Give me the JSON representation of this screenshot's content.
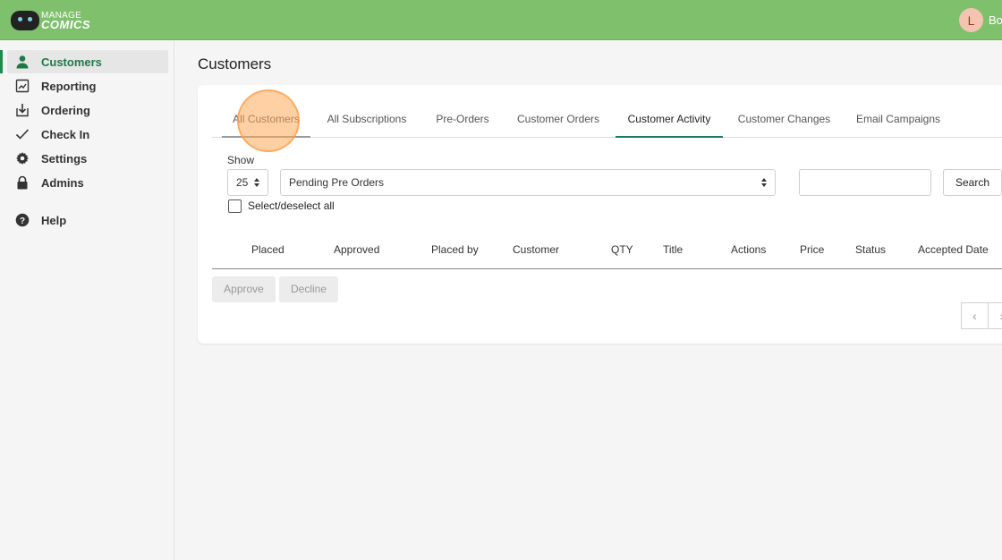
{
  "header": {
    "logo_line1": "MANAGE",
    "logo_line2": "COMICS",
    "avatar_initial": "L",
    "user_name": "Bo"
  },
  "sidebar": {
    "items": [
      {
        "label": "Customers",
        "icon": "user-icon",
        "active": true
      },
      {
        "label": "Reporting",
        "icon": "report-icon"
      },
      {
        "label": "Ordering",
        "icon": "download-icon"
      },
      {
        "label": "Check In",
        "icon": "check-icon"
      },
      {
        "label": "Settings",
        "icon": "gear-icon"
      },
      {
        "label": "Admins",
        "icon": "lock-icon"
      },
      {
        "label": "Help",
        "icon": "help-icon"
      }
    ]
  },
  "page": {
    "title": "Customers"
  },
  "tabs": [
    {
      "label": "All Customers",
      "state": "hover"
    },
    {
      "label": "All Subscriptions"
    },
    {
      "label": "Pre-Orders"
    },
    {
      "label": "Customer Orders"
    },
    {
      "label": "Customer Activity",
      "state": "active"
    },
    {
      "label": "Customer Changes"
    },
    {
      "label": "Email Campaigns"
    }
  ],
  "filters": {
    "show_label": "Show",
    "page_size": "25",
    "filter_value": "Pending Pre Orders",
    "search_value": "",
    "search_button": "Search",
    "select_all_label": "Select/deselect all"
  },
  "table": {
    "columns": [
      "Placed",
      "Approved",
      "Placed by",
      "Customer",
      "QTY",
      "Title",
      "Actions",
      "Price",
      "Status",
      "Accepted Date"
    ]
  },
  "actions": {
    "approve": "Approve",
    "decline": "Decline"
  },
  "pager": {
    "prev": "‹",
    "next": "›"
  },
  "colors": {
    "header_bg": "#7fc06d",
    "accent": "#1e7a45",
    "click_indicator": "#ffaa5a"
  }
}
